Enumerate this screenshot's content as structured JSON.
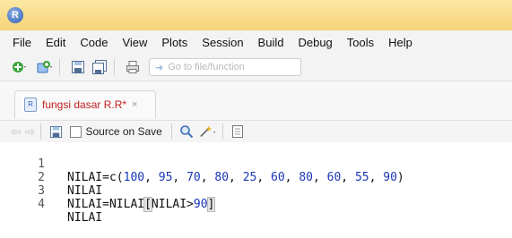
{
  "app": {
    "logo_letter": "R"
  },
  "menu": [
    "File",
    "Edit",
    "Code",
    "View",
    "Plots",
    "Session",
    "Build",
    "Debug",
    "Tools",
    "Help"
  ],
  "toolbar": {
    "goto_placeholder": "Go to file/function"
  },
  "tab": {
    "label": "fungsi dasar R.R*",
    "close": "×"
  },
  "editor_toolbar": {
    "source_on_save_label": "Source on Save"
  },
  "code": {
    "line_numbers": [
      "1",
      "2",
      "3",
      "4"
    ],
    "line1": {
      "prefix": "NILAI=c(",
      "values": [
        "100",
        "95",
        "70",
        "80",
        "25",
        "60",
        "80",
        "60",
        "55",
        "90"
      ],
      "suffix": ")"
    },
    "line2": "NILAI",
    "line3": {
      "prefix": "NILAI=NILAI",
      "open": "[",
      "cond": "NILAI>",
      "threshold": "90",
      "close": "]"
    },
    "line4": "NILAI"
  },
  "colors": {
    "title_bar": "#f5d277",
    "number": "#1a36b8",
    "modified_tab_text": "#c01e1e"
  }
}
